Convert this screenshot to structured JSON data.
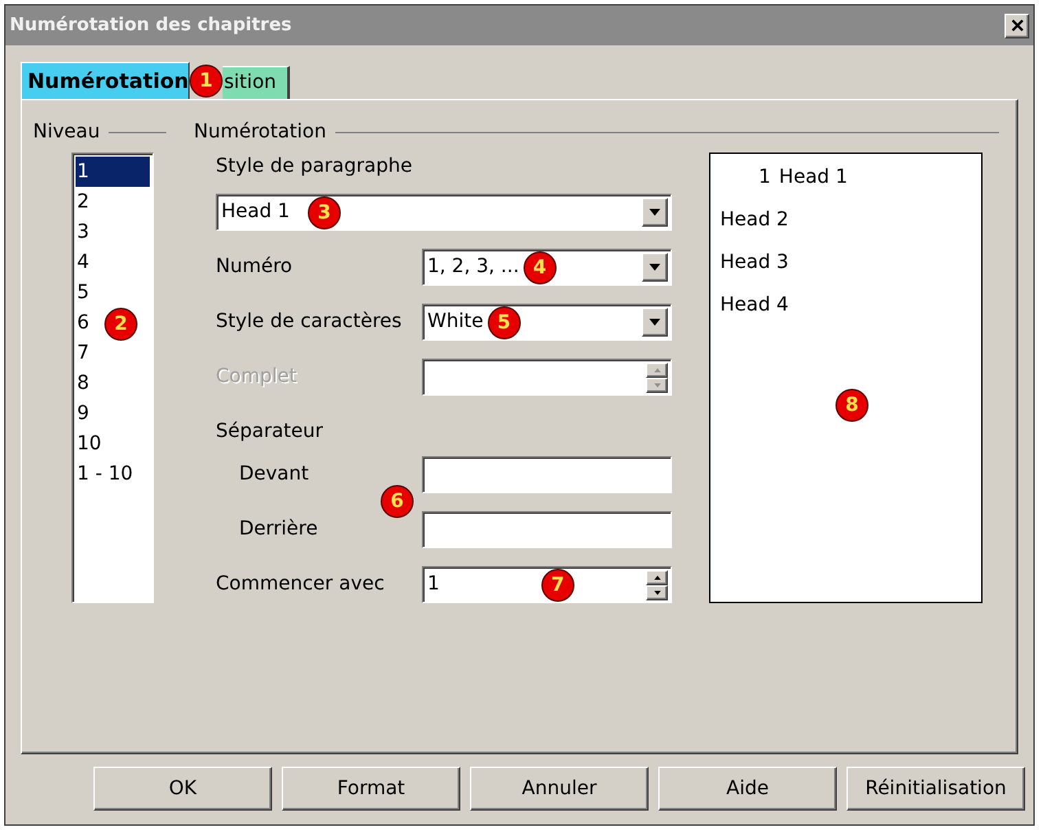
{
  "window": {
    "title": "Numérotation des chapitres"
  },
  "tabs": {
    "callout": "1",
    "items": [
      {
        "label": "Numérotation",
        "selected": true
      },
      {
        "label": "sition",
        "selected": false
      }
    ]
  },
  "level_group": {
    "title": "Niveau",
    "callout": "2",
    "levels": [
      {
        "label": "1",
        "selected": true
      },
      {
        "label": "2",
        "selected": false
      },
      {
        "label": "3",
        "selected": false
      },
      {
        "label": "4",
        "selected": false
      },
      {
        "label": "5",
        "selected": false
      },
      {
        "label": "6",
        "selected": false
      },
      {
        "label": "7",
        "selected": false
      },
      {
        "label": "8",
        "selected": false
      },
      {
        "label": "9",
        "selected": false
      },
      {
        "label": "10",
        "selected": false
      },
      {
        "label": "1 - 10",
        "selected": false
      }
    ]
  },
  "numbering_group": {
    "title": "Numérotation",
    "fields": [
      {
        "kind": "combo",
        "label": "Style de paragraphe",
        "value": "Head 1",
        "callout": "3",
        "disabled": false
      },
      {
        "kind": "dropdown",
        "label": "Numéro",
        "value": "1, 2, 3, ...",
        "callout": "4",
        "disabled": false
      },
      {
        "kind": "dropdown",
        "label": "Style de caractères",
        "value": "White",
        "callout": "5",
        "disabled": false
      },
      {
        "kind": "spin",
        "label": "Complet",
        "disabled": true
      },
      {
        "kind": "heading",
        "label": "Séparateur",
        "disabled": false,
        "children": [
          {
            "kind": "input",
            "label": "Devant",
            "callout": "6",
            "disabled": false
          },
          {
            "kind": "input",
            "label": "Derrière",
            "disabled": false
          }
        ]
      },
      {
        "kind": "spin",
        "label": "Commencer avec",
        "value": "1",
        "callout": "7",
        "disabled": false
      }
    ]
  },
  "preview": {
    "callout": "8",
    "lines": [
      {
        "number": "1",
        "text": "Head 1"
      },
      {
        "text": "Head 2"
      },
      {
        "text": "Head 3"
      },
      {
        "text": "Head 4"
      }
    ]
  },
  "buttons": [
    "OK",
    "Format",
    "Annuler",
    "Aide",
    "Réinitialisation"
  ]
}
